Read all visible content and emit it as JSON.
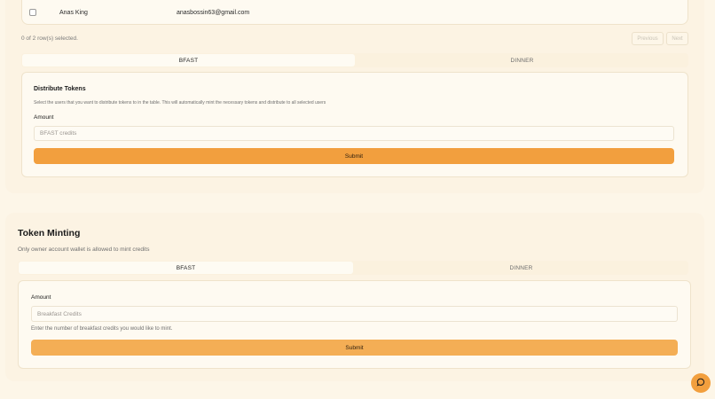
{
  "table": {
    "row": {
      "name": "Anas King",
      "email": "anasbossin63@gmail.com"
    },
    "rows_selected": "0 of 2 row(s) selected.",
    "previous_label": "Previous",
    "next_label": "Next"
  },
  "distribute": {
    "tabs": [
      "BFAST",
      "DINNER"
    ],
    "title": "Distribute Tokens",
    "description": "Select the users that you want to distribute tokens to in the table. This will automatically mint the necessary tokens and distribute to all selected users",
    "amount_label": "Amount",
    "amount_placeholder": "BFAST credits",
    "submit_label": "Submit"
  },
  "minting": {
    "title": "Token Minting",
    "description": "Only owner account wallet is allowed to mint credits",
    "tabs": [
      "BFAST",
      "DINNER"
    ],
    "amount_label": "Amount",
    "amount_placeholder": "Breakfast Credits",
    "helper": "Enter the number of breakfast credits you would like to mint.",
    "submit_label": "Submit"
  },
  "colors": {
    "accent": "#f29f3e",
    "background": "#fdf6e8"
  },
  "icons": {
    "chat": "chat-bubble-icon"
  }
}
